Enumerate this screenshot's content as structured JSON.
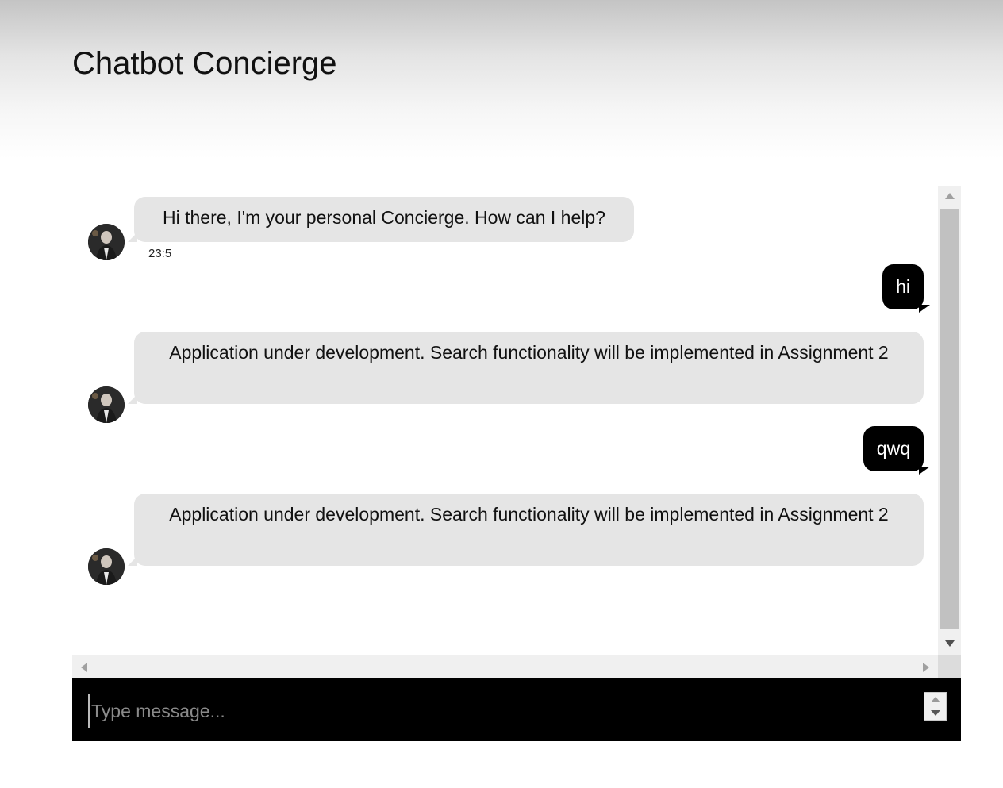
{
  "header": {
    "title": "Chatbot Concierge"
  },
  "messages": [
    {
      "from": "bot",
      "text": "Hi there, I'm your personal Concierge. How can I help?",
      "time": "23:5"
    },
    {
      "from": "user",
      "text": "hi"
    },
    {
      "from": "bot",
      "text": "Application under development. Search functionality will be implemented in Assignment 2"
    },
    {
      "from": "user",
      "text": "qwq"
    },
    {
      "from": "bot",
      "text": "Application under development. Search functionality will be implemented in Assignment 2"
    }
  ],
  "composer": {
    "placeholder": "Type message...",
    "value": ""
  },
  "colors": {
    "bot_bubble": "#e5e5e5",
    "user_bubble": "#000000",
    "input_bar": "#000000"
  },
  "icons": {
    "avatar": "bot-avatar-photo",
    "scroll_up": "triangle-up-icon",
    "scroll_down": "triangle-down-icon",
    "scroll_left": "triangle-left-icon",
    "scroll_right": "triangle-right-icon"
  }
}
